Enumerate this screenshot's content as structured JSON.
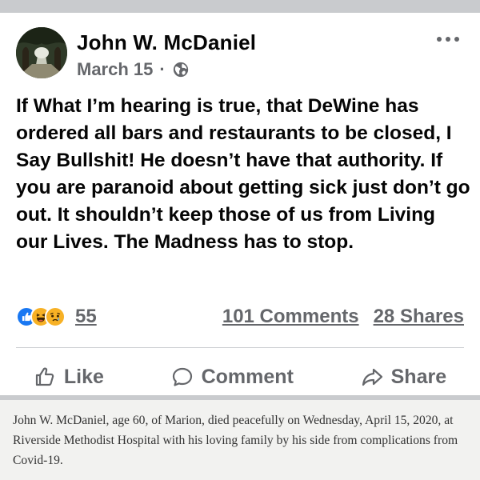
{
  "post": {
    "author": "John W. McDaniel",
    "date": "March 15",
    "separator": "·",
    "privacy_icon": "globe-icon",
    "more_icon": "more-options-icon",
    "text": "If What I’m hearing is true, that DeWine has ordered all bars and restaurants to be closed, I Say Bullshit! He doesn’t have that authority. If you are paranoid about getting sick just don’t go out. It shouldn’t keep those of us from Living our Lives. The Madness has to stop.",
    "reactions": {
      "icons": [
        "like-reaction-icon",
        "haha-reaction-icon",
        "sad-reaction-icon"
      ],
      "count": "55"
    },
    "comments": "101 Comments",
    "shares": "28 Shares",
    "actions": {
      "like": "Like",
      "comment": "Comment",
      "share": "Share"
    }
  },
  "caption": {
    "text": "John W. McDaniel, age 60, of Marion, died peacefully on Wednesday, April 15, 2020, at Riverside Methodist Hospital with his loving family by his side from complications from Covid-19."
  },
  "colors": {
    "text_primary": "#050505",
    "text_secondary": "#65676b",
    "like_blue": "#1877f2",
    "emoji_yellow": "#f7b125",
    "caption_bg": "#f2f2f0",
    "page_bg": "#c9cbce"
  }
}
